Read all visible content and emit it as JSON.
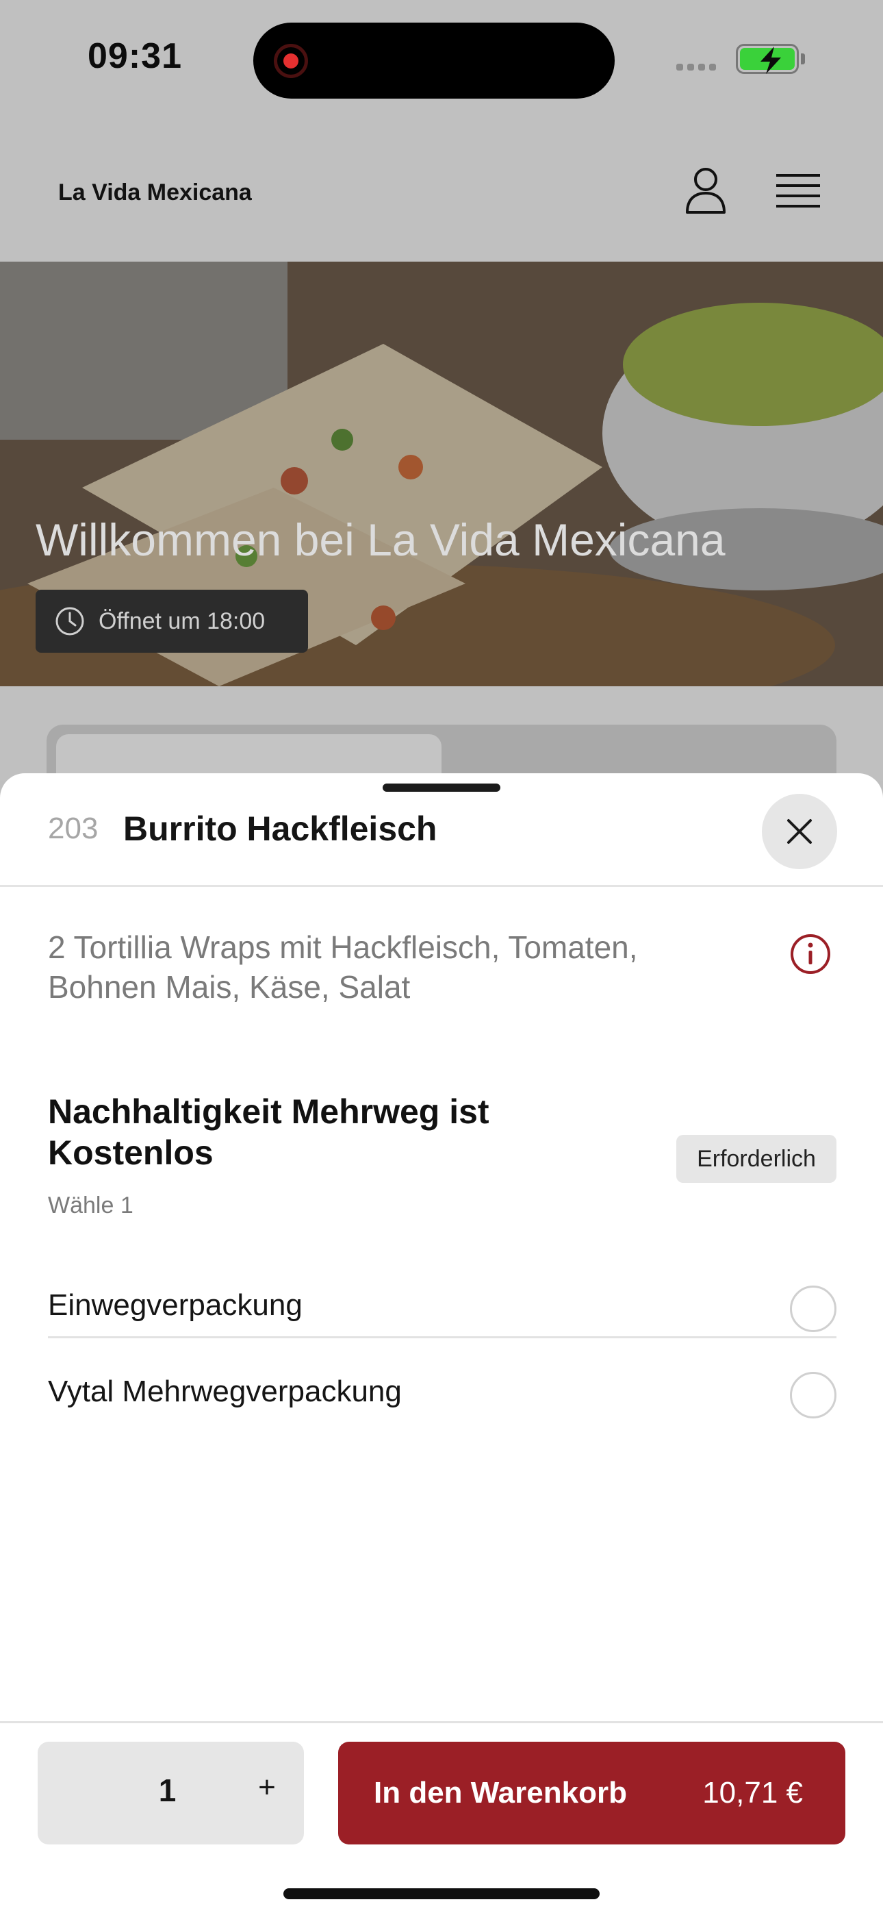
{
  "status_bar": {
    "time": "09:31",
    "battery_color": "#3ad13a",
    "recording_color": "#e53030"
  },
  "header": {
    "brand": "La Vida Mexicana",
    "user_icon": "user-icon",
    "menu_icon": "hamburger-menu-icon"
  },
  "hero": {
    "title": "Willkommen bei La Vida Mexicana",
    "opening_badge": "Öffnet um 18:00",
    "badge_icon": "clock-icon"
  },
  "sheet": {
    "item_number": "203",
    "item_title": "Burrito Hackfleisch",
    "description": "2 Tortillia Wraps mit Hackfleisch, Tomaten, Bohnen Mais, Käse, Salat",
    "option_group": {
      "title": "Nachhaltigkeit Mehrweg ist Kostenlos",
      "required_label": "Erforderlich",
      "hint": "Wähle 1",
      "options": [
        {
          "label": "Einwegverpackung",
          "selected": false
        },
        {
          "label": "Vytal Mehrwegverpackung",
          "selected": false
        }
      ]
    },
    "quantity": "1",
    "plus_label": "+",
    "add_to_cart_label": "In den Warenkorb",
    "price": "10,71 €",
    "accent_color": "#9b1f26"
  }
}
